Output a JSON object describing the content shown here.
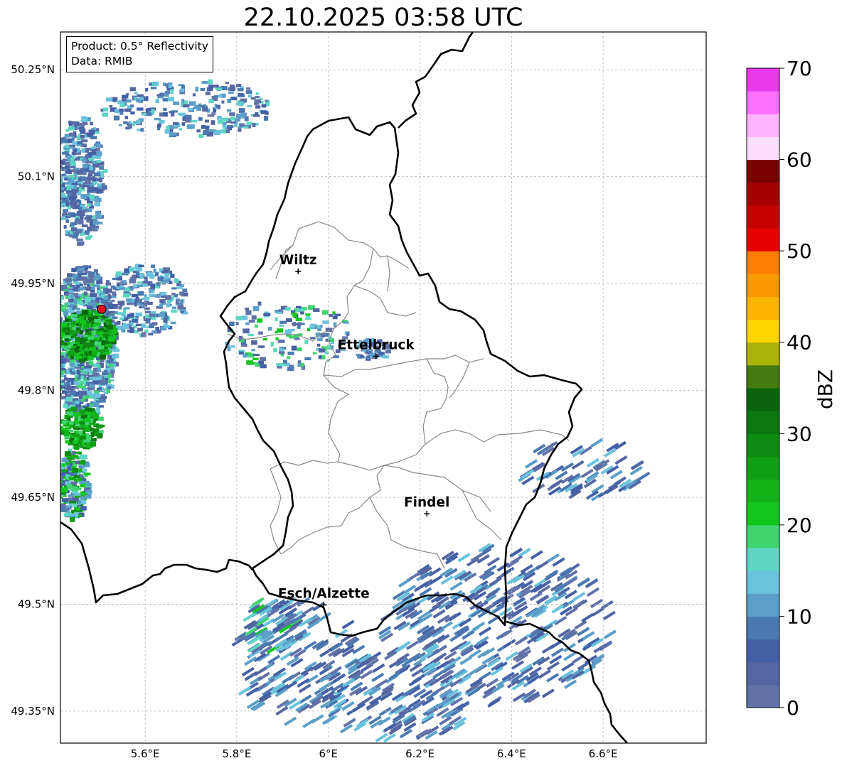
{
  "title": "22.10.2025 03:58 UTC",
  "info": {
    "product": "Product: 0.5° Reflectivity",
    "data": "Data: RMIB"
  },
  "map": {
    "lon_range": [
      5.415,
      6.825
    ],
    "lat_range": [
      49.305,
      50.303
    ],
    "lat_ticks": [
      {
        "value": 50.25,
        "label": "50.25°N"
      },
      {
        "value": 50.1,
        "label": "50.1°N"
      },
      {
        "value": 49.95,
        "label": "49.95°N"
      },
      {
        "value": 49.8,
        "label": "49.8°N"
      },
      {
        "value": 49.65,
        "label": "49.65°N"
      },
      {
        "value": 49.5,
        "label": "49.5°N"
      },
      {
        "value": 49.35,
        "label": "49.35°N"
      }
    ],
    "lon_ticks": [
      {
        "value": 5.6,
        "label": "5.6°E"
      },
      {
        "value": 5.8,
        "label": "5.8°E"
      },
      {
        "value": 6.0,
        "label": "6°E"
      },
      {
        "value": 6.2,
        "label": "6.2°E"
      },
      {
        "value": 6.4,
        "label": "6.4°E"
      },
      {
        "value": 6.6,
        "label": "6.6°E"
      }
    ],
    "gridlines": true,
    "cities": [
      {
        "name": "Wiltz",
        "lon": 5.934,
        "lat": 49.967
      },
      {
        "name": "Ettelbruck",
        "lon": 6.104,
        "lat": 49.848
      },
      {
        "name": "Findel",
        "lon": 6.215,
        "lat": 49.627
      },
      {
        "name": "Esch/Alzette",
        "lon": 5.99,
        "lat": 49.499
      }
    ],
    "radar_site": {
      "lon": 5.505,
      "lat": 49.914,
      "color": "#e8141a"
    }
  },
  "colorbar": {
    "label": "dBZ",
    "min": 0,
    "max": 70,
    "ticks": [
      {
        "value": 0,
        "label": "0"
      },
      {
        "value": 10,
        "label": "10"
      },
      {
        "value": 20,
        "label": "20"
      },
      {
        "value": 30,
        "label": "30"
      },
      {
        "value": 40,
        "label": "40"
      },
      {
        "value": 50,
        "label": "50"
      },
      {
        "value": 60,
        "label": "60"
      },
      {
        "value": 70,
        "label": "70"
      }
    ],
    "colors": [
      "#6272a8",
      "#5466a2",
      "#4460a6",
      "#4b79b0",
      "#5b9ec8",
      "#6ac2dc",
      "#5ed6c4",
      "#3fd46e",
      "#12c61e",
      "#12b41a",
      "#109e14",
      "#0e8a12",
      "#0c7710",
      "#0b640e",
      "#457a10",
      "#aab408",
      "#fdd600",
      "#fbb500",
      "#fb9a00",
      "#fd7e00",
      "#e60000",
      "#c40000",
      "#a60000",
      "#7a0000",
      "#fedefe",
      "#feb4fe",
      "#fd6ffd",
      "#ea38ea"
    ]
  }
}
